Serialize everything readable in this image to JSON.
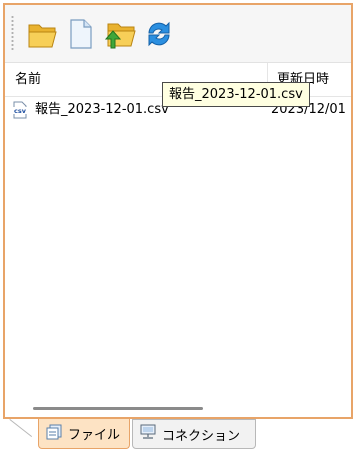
{
  "toolbar": {
    "buttons": [
      {
        "icon": "open-folder-icon"
      },
      {
        "icon": "new-file-icon"
      },
      {
        "icon": "upload-folder-icon"
      },
      {
        "icon": "refresh-icon"
      }
    ]
  },
  "file_list": {
    "columns": {
      "name": "名前",
      "modified": "更新日時"
    },
    "rows": [
      {
        "icon": "csv-file-icon",
        "icon_label": "csv",
        "name": "報告_2023-12-01.csv",
        "modified": "2023/12/01"
      }
    ]
  },
  "tooltip": {
    "text": "報告_2023-12-01.csv"
  },
  "tabs": [
    {
      "label": "ファイル",
      "icon": "files-tab-icon",
      "active": true
    },
    {
      "label": "コネクション",
      "icon": "connection-tab-icon",
      "active": false
    }
  ],
  "colors": {
    "accent_border": "#e8a468",
    "active_tab": "#fde3c4",
    "tooltip_bg": "#ffffe1"
  }
}
